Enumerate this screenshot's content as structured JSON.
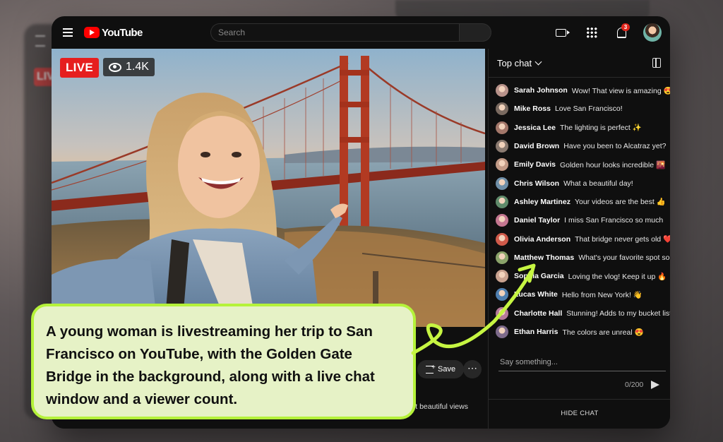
{
  "header": {
    "logo_text": "YouTube",
    "search_placeholder": "Search",
    "notification_count": "3"
  },
  "video": {
    "live_label": "LIVE",
    "viewer_count": "1.4K"
  },
  "below_video": {
    "save_label": "Save",
    "more_label": "⋯",
    "description_fragment": "st beautiful views"
  },
  "chat": {
    "title": "Top chat",
    "messages": [
      {
        "name": "Sarah Johnson",
        "text": "Wow! That view is amazing 😍",
        "color": "#b8928a"
      },
      {
        "name": "Mike Ross",
        "text": "Love San Francisco!",
        "color": "#7a6a60"
      },
      {
        "name": "Jessica Lee",
        "text": "The lighting is perfect ✨",
        "color": "#a3776a"
      },
      {
        "name": "David Brown",
        "text": "Have you been to Alcatraz yet?",
        "color": "#8a7a70"
      },
      {
        "name": "Emily Davis",
        "text": "Golden hour looks incredible 🌇",
        "color": "#c29a86"
      },
      {
        "name": "Chris Wilson",
        "text": "What a beautiful day!",
        "color": "#6f8fa8"
      },
      {
        "name": "Ashley Martinez",
        "text": "Your videos are the best 👍",
        "color": "#5f8a6a"
      },
      {
        "name": "Daniel Taylor",
        "text": "I miss San Francisco so much",
        "color": "#c47690"
      },
      {
        "name": "Olivia Anderson",
        "text": "That bridge never gets old ❤️",
        "color": "#d05a4a"
      },
      {
        "name": "Matthew Thomas",
        "text": "What's your favorite spot so far?",
        "color": "#8aa36a"
      },
      {
        "name": "Sophia Garcia",
        "text": "Loving the vlog! Keep it up 🔥",
        "color": "#c9a28f"
      },
      {
        "name": "Lucas White",
        "text": "Hello from New York! 👋",
        "color": "#4f7fb0"
      },
      {
        "name": "Charlotte Hall",
        "text": "Stunning! Adds to my bucket list",
        "color": "#b57a9a"
      },
      {
        "name": "Ethan Harris",
        "text": "The colors are unreal 😍",
        "color": "#7d6a8a"
      }
    ],
    "input_placeholder": "Say something...",
    "char_counter": "0/200",
    "hide_chat_label": "HIDE CHAT"
  },
  "caption": {
    "text": "A young woman is livestreaming her trip to San Francisco on YouTube, with the Golden Gate Bridge in the background, along with a live chat window and a viewer count."
  },
  "colors": {
    "accent_red": "#e61e1e",
    "caption_border": "#b5f23a",
    "caption_bg": "#e6f2c6"
  }
}
